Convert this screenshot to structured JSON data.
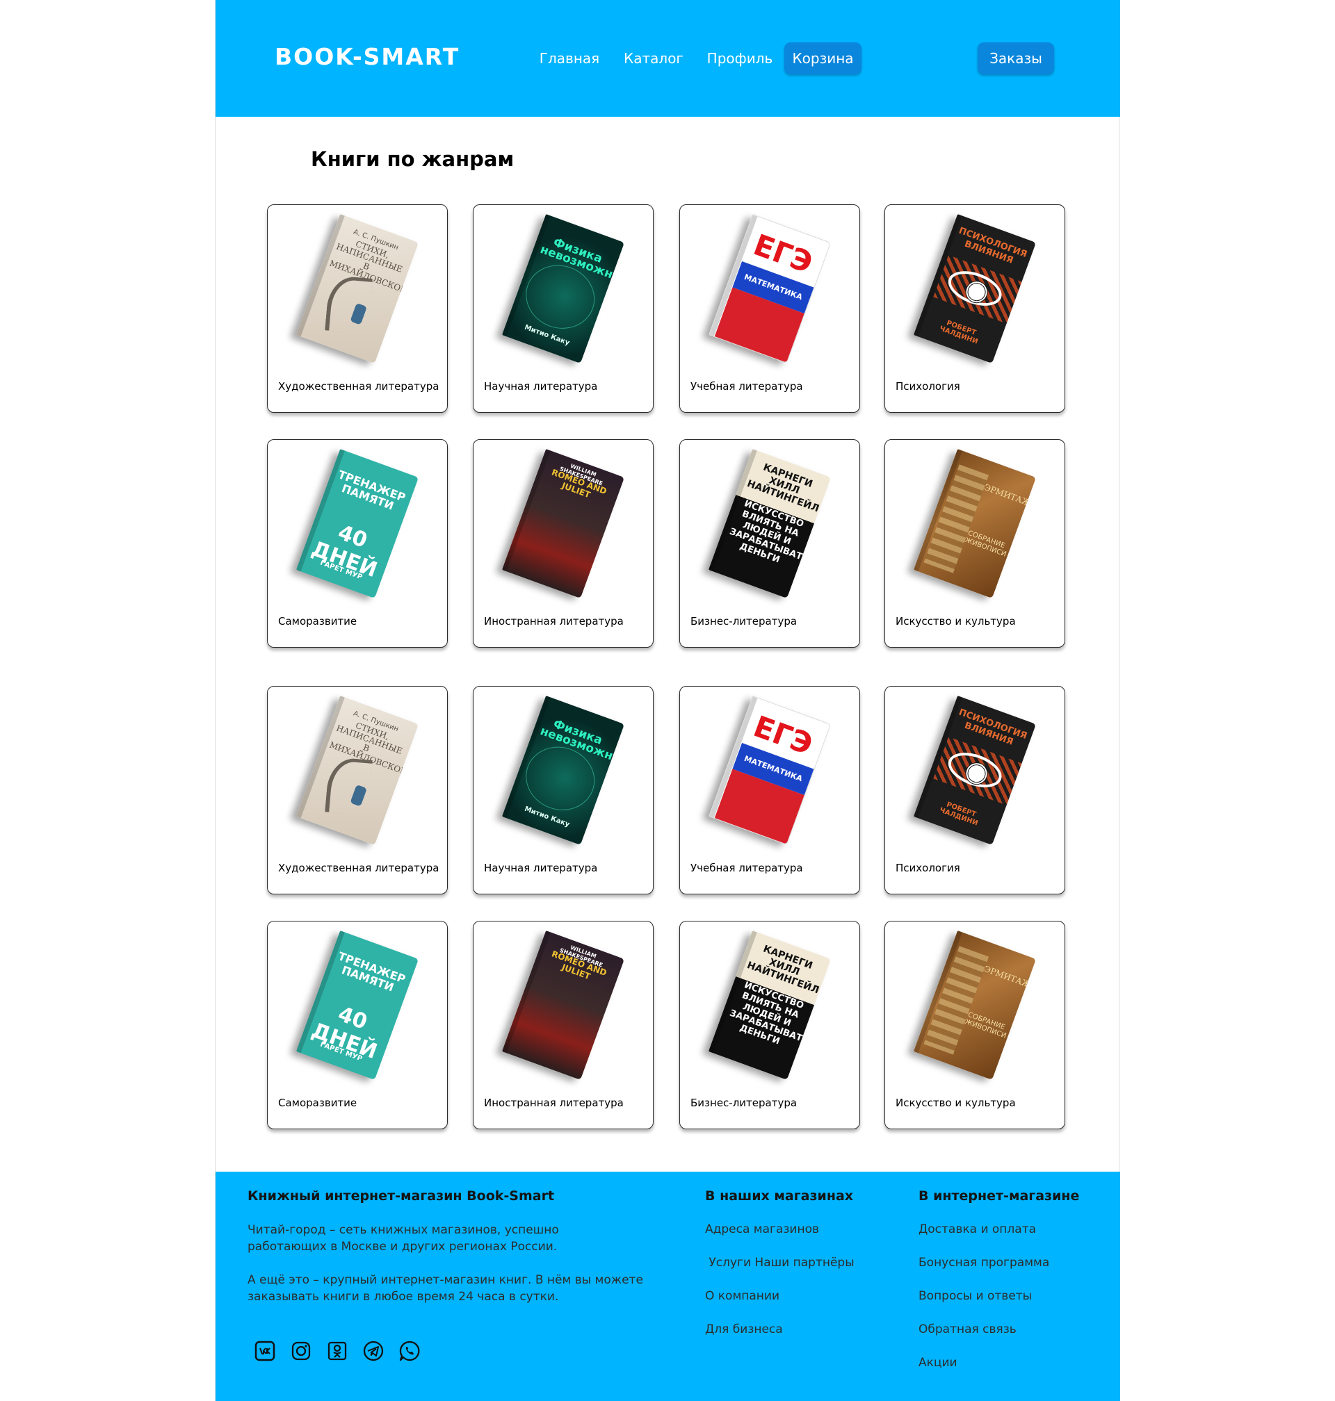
{
  "header": {
    "logo": "BOOK-SMART",
    "nav": {
      "home": "Главная",
      "catalog": "Каталог",
      "profile": "Профиль",
      "cart": "Корзина",
      "orders": "Заказы"
    },
    "colors": {
      "background": "#00b4ff",
      "button": "#0a86dc"
    }
  },
  "main": {
    "title": "Книги по жанрам",
    "genres": [
      {
        "label": "Художественная литература",
        "cover": {
          "title": "СТИХИ, НАПИСАННЫЕ В МИХАЙЛОВСКОМ",
          "author": "А. С. Пушкин"
        }
      },
      {
        "label": "Научная литература",
        "cover": {
          "title": "Физика невозможного",
          "author": "Митио Каку"
        }
      },
      {
        "label": "Учебная литература",
        "cover": {
          "title": "ЕГЭ",
          "subtitle": "МАТЕМАТИКА"
        }
      },
      {
        "label": "Психология",
        "cover": {
          "title": "ПСИХОЛОГИЯ ВЛИЯНИЯ",
          "author": "РОБЕРТ ЧАЛДИНИ"
        }
      },
      {
        "label": "Саморазвитие",
        "cover": {
          "title": "ТРЕНАЖЕР ПАМЯТИ",
          "number": "40 ДНЕЙ",
          "author": "ГАРЕТ МУР"
        }
      },
      {
        "label": "Иностранная литература",
        "cover": {
          "title": "ROMEO AND JULIET",
          "author": "WILLIAM SHAKESPEARE"
        }
      },
      {
        "label": "Бизнес-литература",
        "cover": {
          "title": "КАРНЕГИ ХИЛЛ НАЙТИНГЕЙЛ",
          "subtitle": "ИСКУССТВО ВЛИЯТЬ НА ЛЮДЕЙ И ЗАРАБАТЫВАТЬ ДЕНЬГИ"
        }
      },
      {
        "label": "Искусство и культура",
        "cover": {
          "title": "ЭРМИТАЖ",
          "subtitle": "СОБРАНИЕ ЖИВОПИСИ"
        }
      },
      {
        "label": "Художественная литература",
        "cover": {
          "title": "СТИХИ, НАПИСАННЫЕ В МИХАЙЛОВСКОМ",
          "author": "А. С. Пушкин"
        }
      },
      {
        "label": "Научная литература",
        "cover": {
          "title": "Физика невозможного",
          "author": "Митио Каку"
        }
      },
      {
        "label": "Учебная литература",
        "cover": {
          "title": "ЕГЭ",
          "subtitle": "МАТЕМАТИКА"
        }
      },
      {
        "label": "Психология",
        "cover": {
          "title": "ПСИХОЛОГИЯ ВЛИЯНИЯ",
          "author": "РОБЕРТ ЧАЛДИНИ"
        }
      },
      {
        "label": "Саморазвитие",
        "cover": {
          "title": "ТРЕНАЖЕР ПАМЯТИ",
          "number": "40 ДНЕЙ",
          "author": "ГАРЕТ МУР"
        }
      },
      {
        "label": "Иностранная литература",
        "cover": {
          "title": "ROMEO AND JULIET",
          "author": "WILLIAM SHAKESPEARE"
        }
      },
      {
        "label": "Бизнес-литература",
        "cover": {
          "title": "КАРНЕГИ ХИЛЛ НАЙТИНГЕЙЛ",
          "subtitle": "ИСКУССТВО ВЛИЯТЬ НА ЛЮДЕЙ И ЗАРАБАТЫВАТЬ ДЕНЬГИ"
        }
      },
      {
        "label": "Искусство и культура",
        "cover": {
          "title": "ЭРМИТАЖ",
          "subtitle": "СОБРАНИЕ ЖИВОПИСИ"
        }
      }
    ]
  },
  "footer": {
    "about": {
      "title": "Книжный интернет-магазин Book-Smart",
      "p1": "Читай-город – сеть книжных магазинов, успешно работающих в Москве и других регионах России.",
      "p2": "А ещё это – крупный интернет-магазин книг. В нём вы можете заказывать книги в любое время 24 часа в сутки."
    },
    "stores": {
      "title": "В наших магазинах",
      "links": [
        "Адреса магазинов",
        " Услуги Наши партнёры",
        "О компании",
        "Для бизнеса"
      ]
    },
    "online": {
      "title": "В интернет-магазине",
      "links": [
        "Доставка и оплата",
        "Бонусная программа",
        "Вопросы и ответы",
        "Обратная связь",
        "Акции"
      ]
    },
    "social_icons": [
      "vk-icon",
      "instagram-icon",
      "odnoklassniki-icon",
      "telegram-icon",
      "whatsapp-icon"
    ]
  }
}
